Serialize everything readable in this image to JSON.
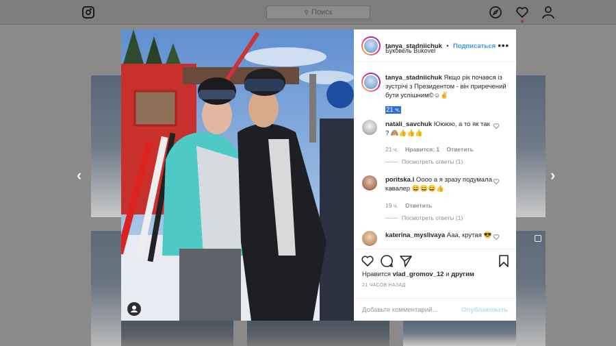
{
  "topbar": {
    "search_placeholder": "Поиск"
  },
  "post": {
    "username": "tanya_stadniichuk",
    "separator": "•",
    "follow_label": "Подписаться",
    "location": "Буковель Bukovel",
    "caption_username": "tanya_stadniichuk",
    "caption_text": "Якщо рік почався із зустрічі з Президентом - він приречений бути успішним©☺✌",
    "caption_time": "21 ч.",
    "likes_prefix": "Нравится",
    "likes_user": "vlad_gromov_12",
    "likes_conj": "и",
    "likes_others": "другим",
    "post_time": "21 ЧАСОВ НАЗАД",
    "add_comment_placeholder": "Добавьте комментарий...",
    "publish_label": "Опубликовать"
  },
  "comments": [
    {
      "username": "natali_savchuk",
      "text": "Юююю, а то як так ? 🙈👍👍👍",
      "time": "21 ч.",
      "likes": "Нравится: 1",
      "reply": "Ответить",
      "view_replies": "Посмотреть ответы (1)"
    },
    {
      "username": "poritska.l",
      "text": "Оооо а я зразу подумала кавалер 😄😄😄👍",
      "time": "19 ч.",
      "reply": "Ответить",
      "view_replies": "Посмотреть ответы (1)"
    },
    {
      "username": "katerina_myslivaya",
      "text": "Ааа, крутая 😎"
    }
  ],
  "colors": {
    "link_blue": "#3897f0",
    "publish_disabled": "#b2dffc",
    "overlay": "#8a8a8a"
  }
}
